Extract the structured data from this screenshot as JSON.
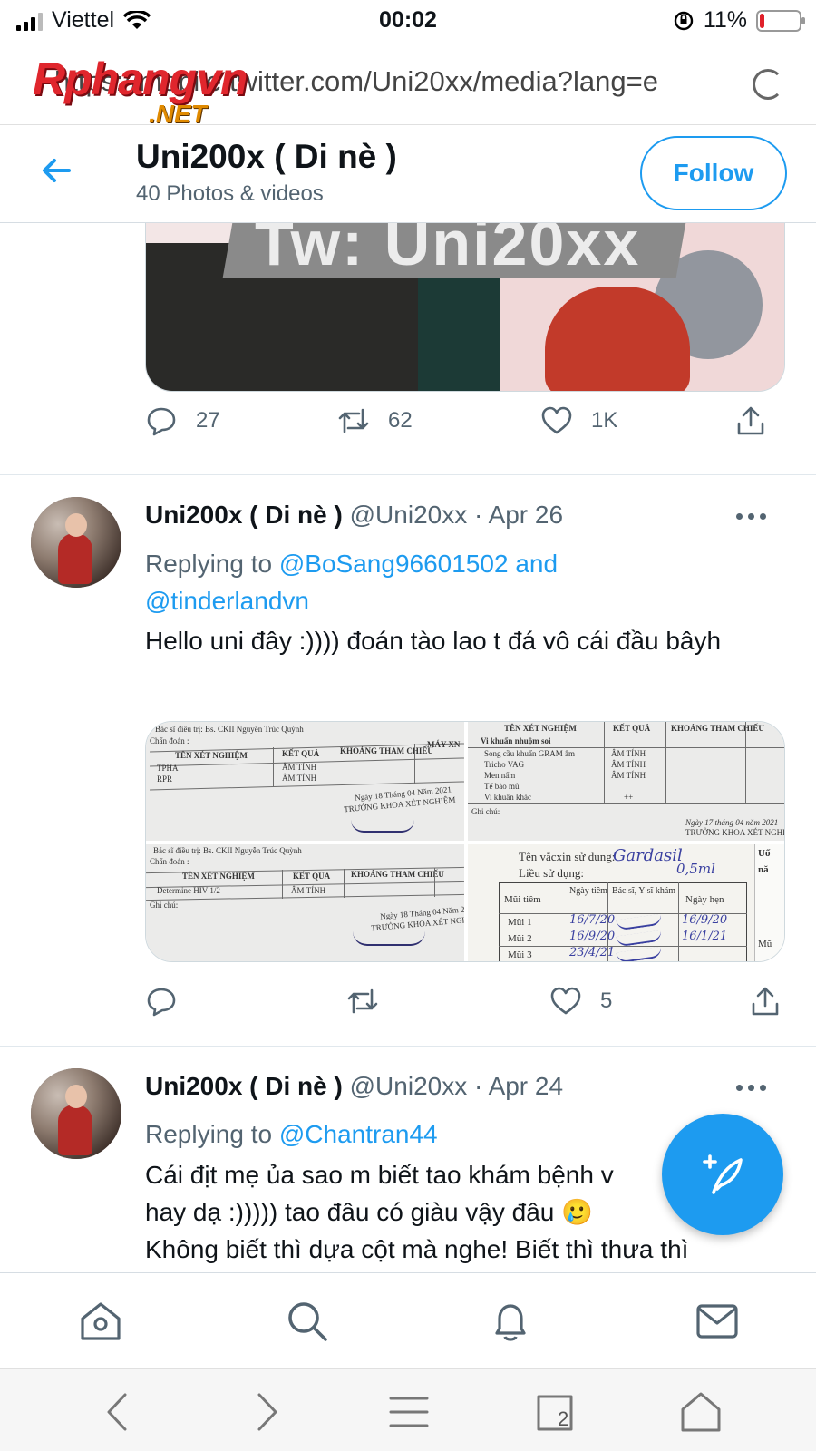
{
  "status_bar": {
    "carrier": "Viettel",
    "time": "00:02",
    "battery_percent": "11%",
    "battery_level": 0.11,
    "icons": [
      "signal-icon",
      "wifi-icon",
      "orientation-lock-icon",
      "battery-icon"
    ]
  },
  "browser": {
    "url": "https://mobile.twitter.com/Uni20xx/media?lang=en",
    "url_display": "https://mobile.twitter.com/Uni20xx/media?lang=e",
    "watermark_main": "Rphangvn",
    "watermark_sub": ".NET",
    "toolbar_icons": [
      "back-icon",
      "forward-icon",
      "menu-icon",
      "tabs-icon",
      "home-icon"
    ],
    "tab_count": "2"
  },
  "header": {
    "name": "Uni200x ( Di nè )",
    "subtitle": "40 Photos & videos",
    "follow_label": "Follow"
  },
  "media1": {
    "overlay_text": "Tw: Uni20xx"
  },
  "tweet0_actions": {
    "replies": "27",
    "retweets": "62",
    "likes": "1K"
  },
  "tweets": [
    {
      "name": "Uni200x ( Di nè )",
      "handle": "@Uni20xx",
      "sep": "·",
      "date": "Apr 26",
      "replying_prefix": "Replying to",
      "mention1": "@BoSang96601502",
      "and": "and",
      "mention2": "@tinderlandvn",
      "text": "Hello uni đây :)))) đoán tào lao t đá vô cái đầu bâyh",
      "likes": "5"
    },
    {
      "name": "Uni200x ( Di nè )",
      "handle": "@Uni20xx",
      "sep": "·",
      "date": "Apr 24",
      "replying_prefix": "Replying to",
      "mention1": "@Chantran44",
      "line1": "Cái địt mẹ ủa sao m biết tao khám bệnh v",
      "line2": "hay dạ :))))) tao đâu có giàu vậy đâu 🥲",
      "line3": "Không biết thì dựa cột mà nghe! Biết thì thưa thì"
    }
  ],
  "docs": {
    "doc1": {
      "doctor": "Bác sĩ điều trị: Bs. CKII Nguyễn Trúc Quỳnh",
      "diag": "Chẩn đoán :",
      "col1": "TÊN XÉT NGHIỆM",
      "col2": "KẾT QUẢ",
      "col3": "KHOẢNG THAM CHIẾU",
      "col4": "MÁY XN",
      "row1": "TPHA",
      "row2": "RPR",
      "res": "ÂM TÍNH",
      "date": "Ngày 18 Tháng 04 Năm 2021",
      "sign": "TRƯỞNG KHOA XÉT NGHIỆM"
    },
    "doc2": {
      "col1": "TÊN XÉT NGHIỆM",
      "col2": "KẾT QUẢ",
      "col3": "KHOẢNG THAM CHIẾU",
      "row0": "Vi khuẩn nhuộm soi",
      "row1": "Song cầu khuẩn GRAM âm",
      "row2": "Tricho VAG",
      "row3": "Men nấm",
      "row4": "Tế bào mủ",
      "row5": "Vi khuẩn khác",
      "res": "ÂM TÍNH",
      "plus": "++",
      "note": "Ghi chú:",
      "date": "Ngày 17 tháng 04 năm 2021",
      "sign": "TRƯỞNG KHOA XÉT NGHIỆM"
    },
    "doc3": {
      "doctor": "Bác sĩ điều trị: Bs. CKII Nguyễn Trúc Quỳnh",
      "diag": "Chẩn đoán :",
      "col1": "TÊN XÉT NGHIỆM",
      "col2": "KẾT QUẢ",
      "col3": "KHOẢNG THAM CHIẾU",
      "row1": "Determine HIV 1/2",
      "res": "ÂM TÍNH",
      "note": "Ghi chú:",
      "date": "Ngày 18 Tháng 04 Năm 2021",
      "sign": "TRƯỞNG KHOA XÉT NGHIỆM"
    },
    "doc4": {
      "vaccine_label": "Tên vắcxin sử dụng:",
      "vaccine": "Gardasil",
      "dose_label": "Liều sử dụng:",
      "dose": "0,5ml",
      "h1": "Mũi tiêm",
      "h2": "Ngày tiêm",
      "h3": "Bác sĩ, Y sĩ khám",
      "h4": "Ngày hẹn",
      "m1": "Mũi 1",
      "m2": "Mũi 2",
      "m3": "Mũi 3",
      "d1": "16/7/20",
      "d2": "16/9/20",
      "d3": "23/4/21",
      "n1": "16/9/20",
      "n2": "16/1/21",
      "side1": "Uố",
      "side2": "nă",
      "side3": "Mũ"
    }
  },
  "nav_icons": [
    "home-icon",
    "search-icon",
    "notifications-icon",
    "messages-icon"
  ],
  "colors": {
    "accent": "#1d9bf0",
    "text": "#0f1419",
    "muted": "#536471"
  }
}
